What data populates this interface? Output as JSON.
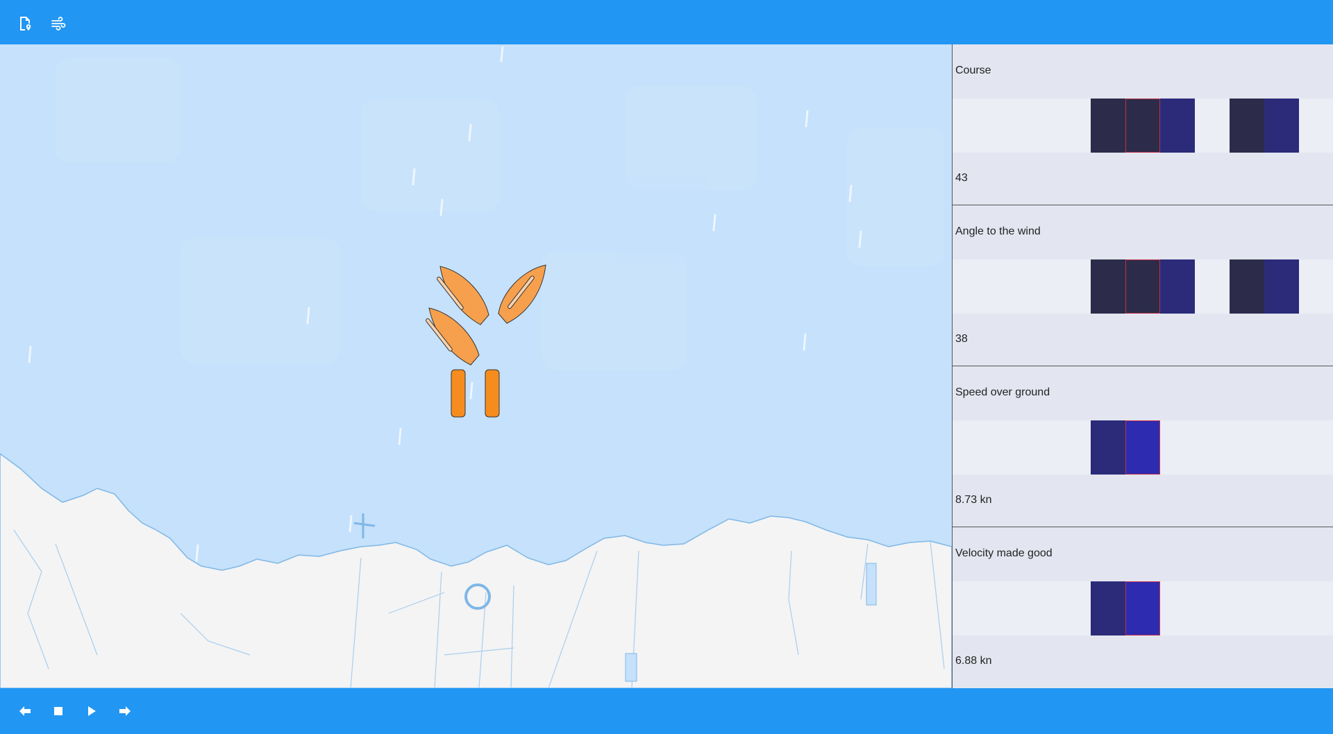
{
  "toolbar": {
    "icons": [
      "document-location-icon",
      "wind-icon"
    ]
  },
  "metrics": [
    {
      "label": "Course",
      "value": "43"
    },
    {
      "label": "Angle to the wind",
      "value": "38"
    },
    {
      "label": "Speed over ground",
      "value": "8.73 kn"
    },
    {
      "label": "Velocity made good",
      "value": "6.88 kn"
    }
  ],
  "playback": {
    "icons": [
      "arrow-left-icon",
      "stop-icon",
      "play-icon",
      "arrow-right-icon"
    ]
  },
  "colors": {
    "accent": "#2196f3",
    "water": "#c5e1fb",
    "land": "#f4f4f4",
    "boat": "#f6a04d",
    "pause": "#f78c1e"
  }
}
